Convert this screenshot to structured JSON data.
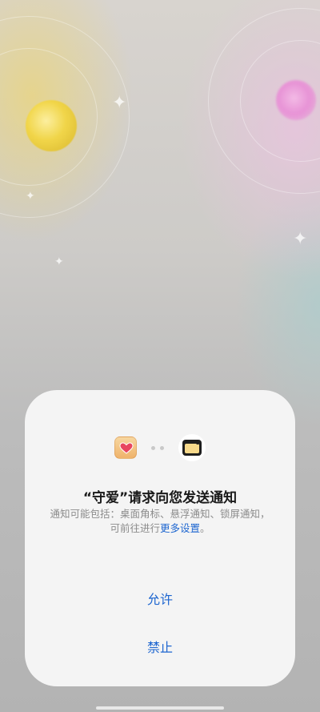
{
  "dialog": {
    "title": "“守爱”请求向您发送通知",
    "description_prefix": "通知可能包括：桌面角标、悬浮通知、锁屏通知，可前往进行",
    "description_link": "更多设置",
    "description_suffix": "。",
    "allow_label": "允许",
    "deny_label": "禁止"
  },
  "icons": {
    "app": "shouai-app-icon",
    "connector": "dots-icon",
    "notification": "notification-icon"
  },
  "colors": {
    "accent": "#1e66d0",
    "sheet_bg": "#f4f4f4",
    "title": "#1a1a1a",
    "description": "#8c8c8c"
  }
}
